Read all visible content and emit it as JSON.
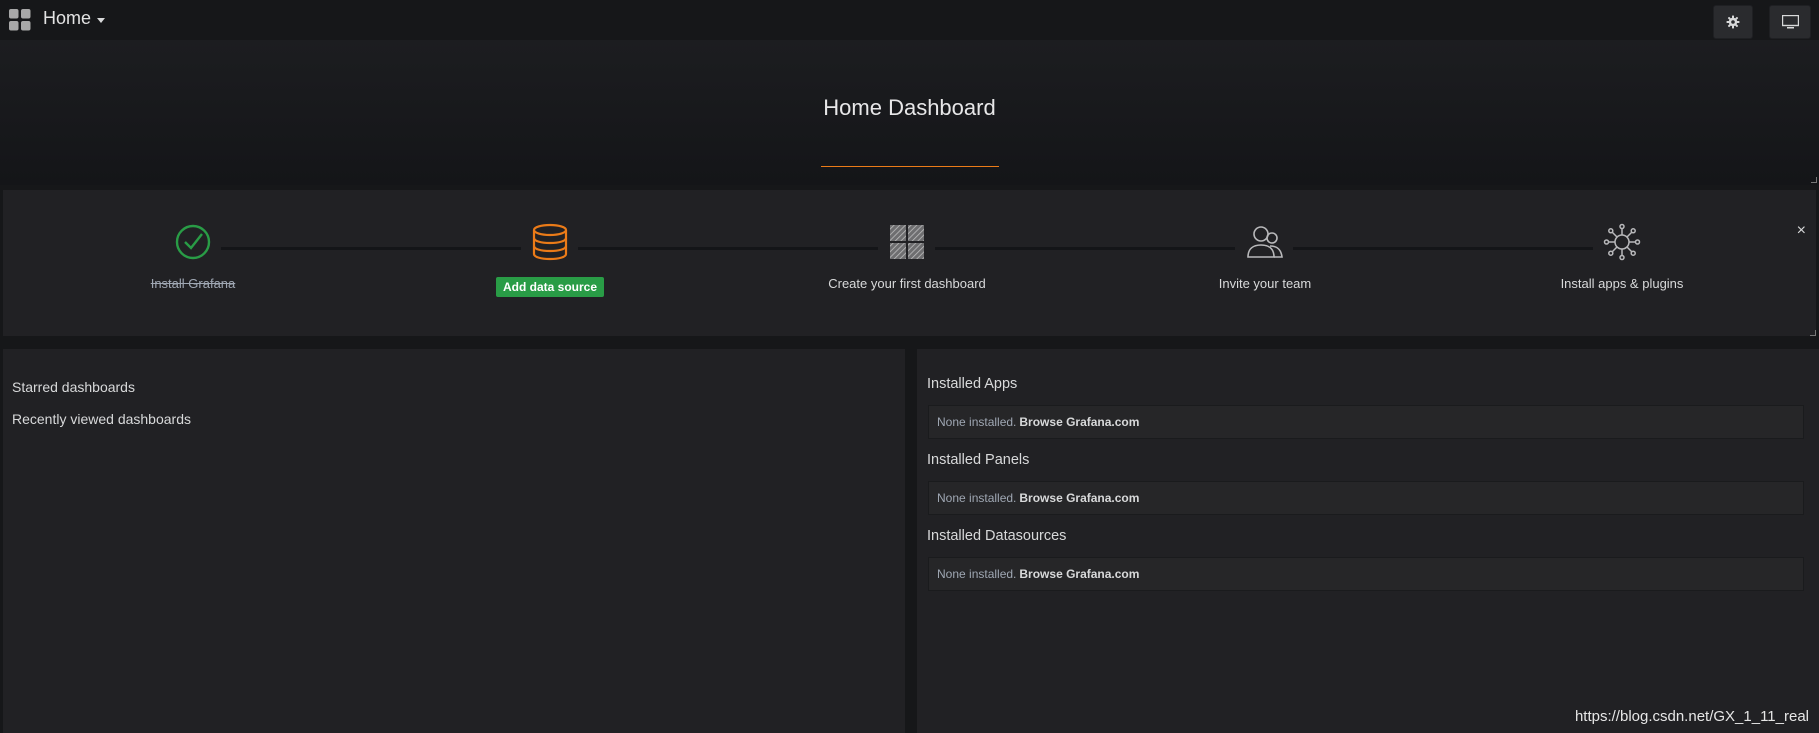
{
  "navbar": {
    "home_label": "Home"
  },
  "header": {
    "title": "Home Dashboard"
  },
  "getting_started": {
    "close_symbol": "×",
    "steps": [
      {
        "label": "Install Grafana",
        "state": "done",
        "icon": "check-circle-icon"
      },
      {
        "label": "Add data source",
        "state": "active",
        "icon": "database-icon"
      },
      {
        "label": "Create your first dashboard",
        "state": "todo",
        "icon": "dashboard-grid-icon"
      },
      {
        "label": "Invite your team",
        "state": "todo",
        "icon": "users-icon"
      },
      {
        "label": "Install apps & plugins",
        "state": "todo",
        "icon": "plugins-icon"
      }
    ]
  },
  "dashboards": {
    "starred": "Starred dashboards",
    "recent": "Recently viewed dashboards"
  },
  "plugins": {
    "apps": {
      "heading": "Installed Apps",
      "text": "None installed.",
      "link": "Browse Grafana.com"
    },
    "panels": {
      "heading": "Installed Panels",
      "text": "None installed.",
      "link": "Browse Grafana.com"
    },
    "datasources": {
      "heading": "Installed Datasources",
      "text": "None installed.",
      "link": "Browse Grafana.com"
    }
  },
  "watermark": "https://blog.csdn.net/GX_1_11_real",
  "colors": {
    "background": "#161719",
    "panel": "#212124",
    "accent_orange": "#eb7b18",
    "success_green": "#299c46"
  }
}
